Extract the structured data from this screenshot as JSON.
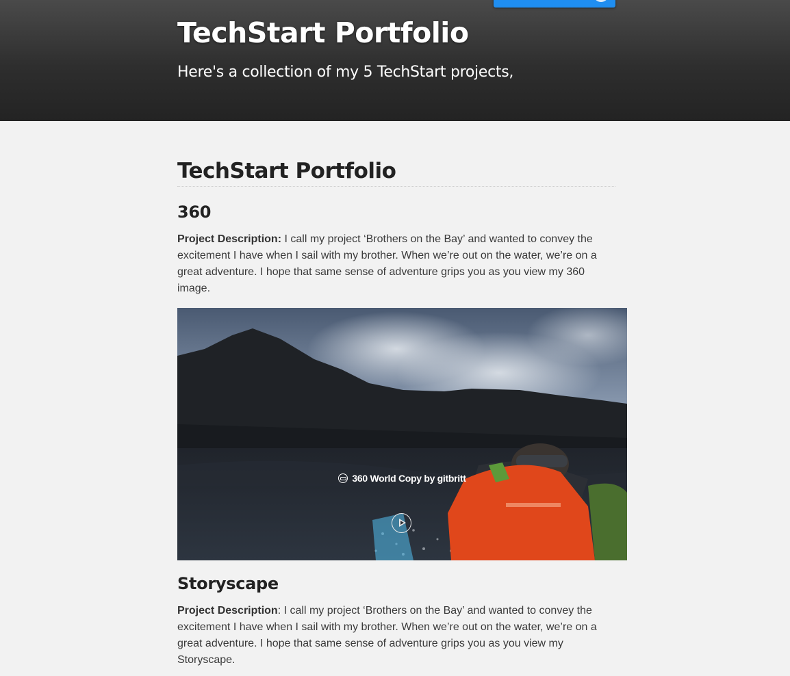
{
  "header": {
    "title": "TechStart Portfolio",
    "tagline": "Here's a collection of my 5 TechStart projects,"
  },
  "main": {
    "heading": "TechStart Portfolio",
    "projects": [
      {
        "title": "360",
        "desc_label": "Project Description:",
        "desc_text": " I call my project ‘Brothers on the Bay’ and wanted to convey the excitement I have when I sail with my brother. When we’re out on the water, we’re on a great adventure. I hope that same sense of adventure grips you as you view my 360 image.",
        "media_caption": "360 World Copy by gitbritt",
        "play_icon": "play-icon",
        "caption_icon": "vr-headset-icon"
      },
      {
        "title": "Storyscape",
        "desc_label": "Project Description",
        "desc_text": ": I call my project ‘Brothers on the Bay’ and wanted to convey the excitement I have when I sail with my brother. When we’re out on the water, we’re on a great adventure. I hope that same sense of adventure grips you as you view my Storyscape."
      }
    ]
  },
  "colors": {
    "header_bg": "#2e2e2e",
    "page_bg": "#f2f2f2",
    "accent": "#1f8ef1",
    "life_jacket": "#e0471b"
  }
}
